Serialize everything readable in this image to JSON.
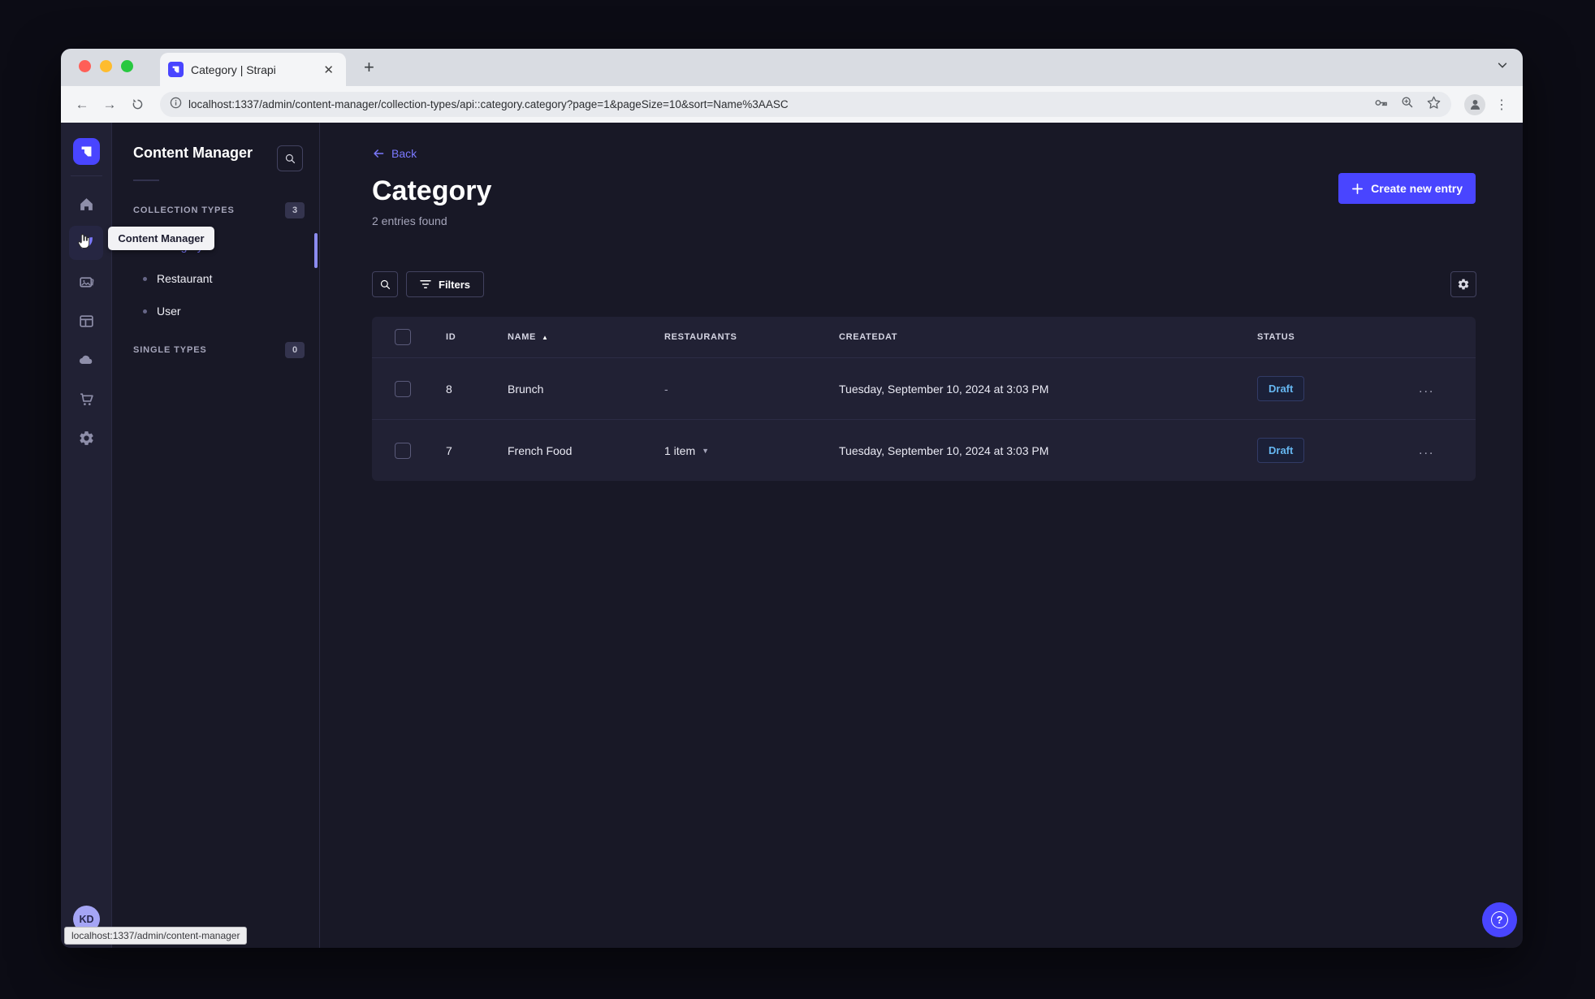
{
  "browser": {
    "tab_title": "Category | Strapi",
    "close_glyph": "✕",
    "new_tab_glyph": "+",
    "back_glyph": "←",
    "forward_glyph": "→",
    "url": "localhost:1337/admin/content-manager/collection-types/api::category.category?page=1&pageSize=10&sort=Name%3AASC",
    "kebab_glyph": "⋮",
    "status_bar_link": "localhost:1337/admin/content-manager"
  },
  "colors": {
    "primary": "#4945ff",
    "link": "#7b79ff",
    "app_bg": "#181826",
    "surface": "#212134",
    "draft_text": "#66b7f1"
  },
  "rail": {
    "icons": [
      "home",
      "content-manager",
      "media-library",
      "content-type-builder",
      "cloud",
      "marketplace",
      "settings"
    ],
    "avatar_initials": "KD",
    "tooltip": "Content Manager"
  },
  "subnav": {
    "title": "Content Manager",
    "sections": [
      {
        "label": "Collection Types",
        "count": "3"
      },
      {
        "label": "Single Types",
        "count": "0"
      }
    ],
    "items": [
      {
        "label": "Category"
      },
      {
        "label": "Restaurant"
      },
      {
        "label": "User"
      }
    ]
  },
  "main": {
    "back_label": "Back",
    "title": "Category",
    "subtitle": "2 entries found",
    "create_button": "Create new entry",
    "filters_button": "Filters",
    "table": {
      "columns": {
        "id": "ID",
        "name": "Name",
        "restaurants": "Restaurants",
        "createdat": "CreatedAt",
        "status": "Status"
      },
      "sort": {
        "column": "Name",
        "direction": "asc",
        "glyph": "▲"
      },
      "rows": [
        {
          "id": "8",
          "name": "Brunch",
          "restaurants": "-",
          "created_at": "Tuesday, September 10, 2024 at 3:03 PM",
          "status": "Draft",
          "actions": "..."
        },
        {
          "id": "7",
          "name": "French Food",
          "restaurants": "1 item",
          "created_at": "Tuesday, September 10, 2024 at 3:03 PM",
          "status": "Draft",
          "actions": "..."
        }
      ]
    }
  },
  "help": {
    "glyph": "?"
  }
}
